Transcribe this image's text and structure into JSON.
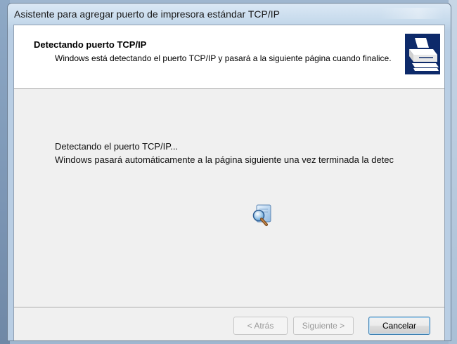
{
  "window": {
    "title": "Asistente para agregar puerto de impresora estándar TCP/IP"
  },
  "header": {
    "title": "Detectando puerto TCP/IP",
    "description": "Windows está detectando el puerto TCP/IP y pasará a la siguiente página cuando finalice.",
    "icon": "printer-network-icon"
  },
  "content": {
    "line1": "Detectando el puerto TCP/IP...",
    "line2": "Windows pasará automáticamente a la página siguiente una vez terminada la detec",
    "animation_icon": "search-animation-icon"
  },
  "buttons": {
    "back": "< Atrás",
    "next": "Siguiente >",
    "cancel": "Cancelar"
  },
  "colors": {
    "header_icon_bg": "#0d2a6a",
    "default_button_border": "#3c7fb1"
  }
}
